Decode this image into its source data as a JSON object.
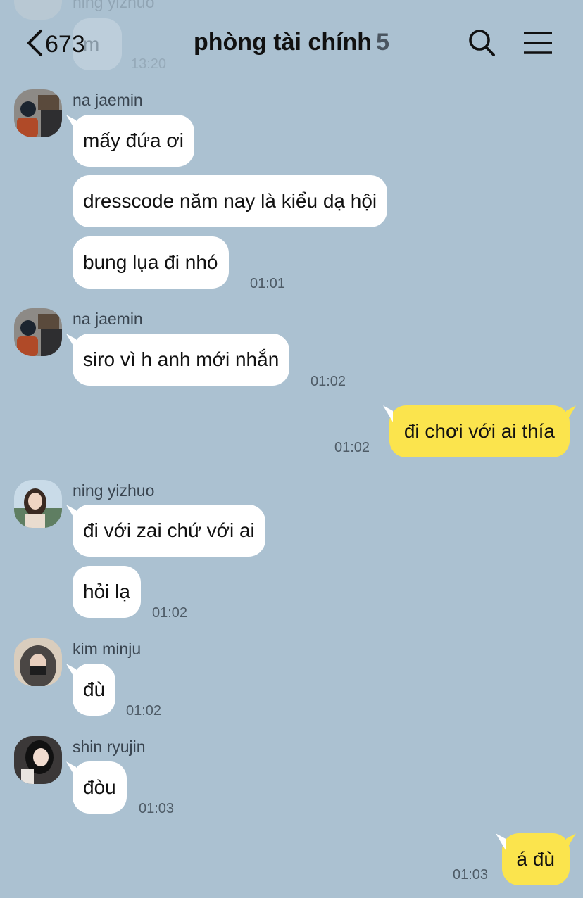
{
  "header": {
    "back_count": "673",
    "title": "phòng tài chính",
    "member_count": "5"
  },
  "ghost_message": {
    "sender": "ning yizhuo",
    "text": "m",
    "time": "13:20"
  },
  "messages": [
    {
      "sender": "na jaemin",
      "bubbles": [
        "mấy đứa ơi",
        "dresscode năm nay là kiểu dạ hội",
        "bung lụa đi nhó"
      ],
      "time": "01:01"
    },
    {
      "sender": "na jaemin",
      "bubbles": [
        "siro vì h anh mới nhắn"
      ],
      "time": "01:02"
    },
    {
      "mine": true,
      "bubbles": [
        "đi chơi với ai thía"
      ],
      "time": "01:02"
    },
    {
      "sender": "ning yizhuo",
      "bubbles": [
        "đi với zai chứ với ai",
        "hỏi lạ"
      ],
      "time": "01:02"
    },
    {
      "sender": "kim minju",
      "bubbles": [
        "đù"
      ],
      "time": "01:02"
    },
    {
      "sender": "shin ryujin",
      "bubbles": [
        "đòu"
      ],
      "time": "01:03"
    },
    {
      "mine": true,
      "bubbles": [
        "á đù"
      ],
      "time": "01:03"
    }
  ],
  "colors": {
    "background": "#abc1d1",
    "my_bubble": "#fbe44d",
    "their_bubble": "#ffffff"
  }
}
